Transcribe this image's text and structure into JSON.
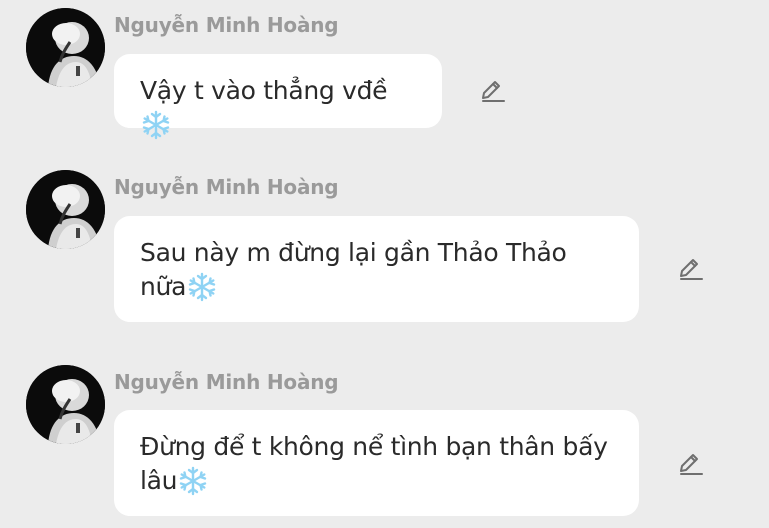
{
  "messages": [
    {
      "sender": "Nguyễn Minh Hoàng",
      "text": "Vậy t vào thẳng vđề",
      "emoji": "snowflake-icon"
    },
    {
      "sender": "Nguyễn Minh Hoàng",
      "text": "Sau này m đừng lại gần Thảo Thảo\nnữa",
      "emoji": "snowflake-icon"
    },
    {
      "sender": "Nguyễn Minh Hoàng",
      "text": "Đừng để t không nể tình bạn thân bấy\nlâu",
      "emoji": "snowflake-icon"
    }
  ],
  "colors": {
    "background": "#ececec",
    "bubble": "#ffffff",
    "sender": "#9a9a9a",
    "text": "#2a2a2a",
    "snowflake": "#8fd3f4",
    "icon": "#6f6f6f"
  }
}
